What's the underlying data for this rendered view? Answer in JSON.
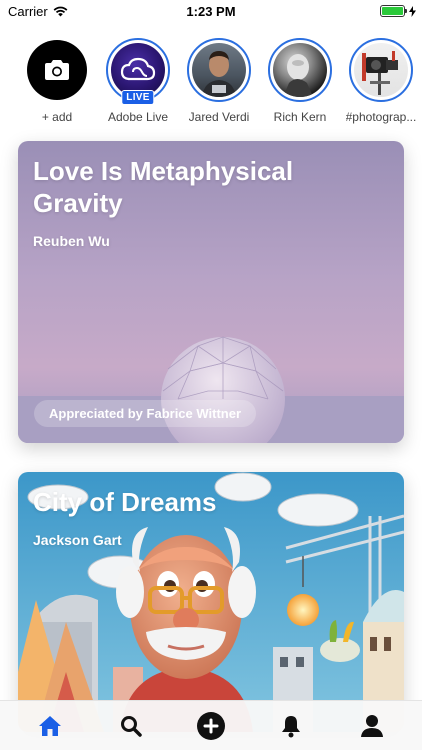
{
  "status_bar": {
    "carrier": "Carrier",
    "time": "1:23 PM",
    "battery_level": 1.0
  },
  "stories": {
    "add_label": "+ add",
    "items": [
      {
        "label": "Adobe Live",
        "badge": "LIVE"
      },
      {
        "label": "Jared Verdi"
      },
      {
        "label": "Rich Kern"
      },
      {
        "label": "#photograp..."
      }
    ]
  },
  "cards": [
    {
      "title": "Love Is Metaphysical Gravity",
      "author": "Reuben Wu",
      "appreciated": "Appreciated by Fabrice Wittner"
    },
    {
      "title": "City of Dreams",
      "author": "Jackson Gart"
    }
  ],
  "tab_bar": {
    "tabs": [
      {
        "icon": "home-icon",
        "active": true
      },
      {
        "icon": "search-icon",
        "active": false
      },
      {
        "icon": "plus-icon",
        "active": false
      },
      {
        "icon": "bell-icon",
        "active": false
      },
      {
        "icon": "profile-icon",
        "active": false
      }
    ],
    "active_color": "#1a5fe6"
  }
}
